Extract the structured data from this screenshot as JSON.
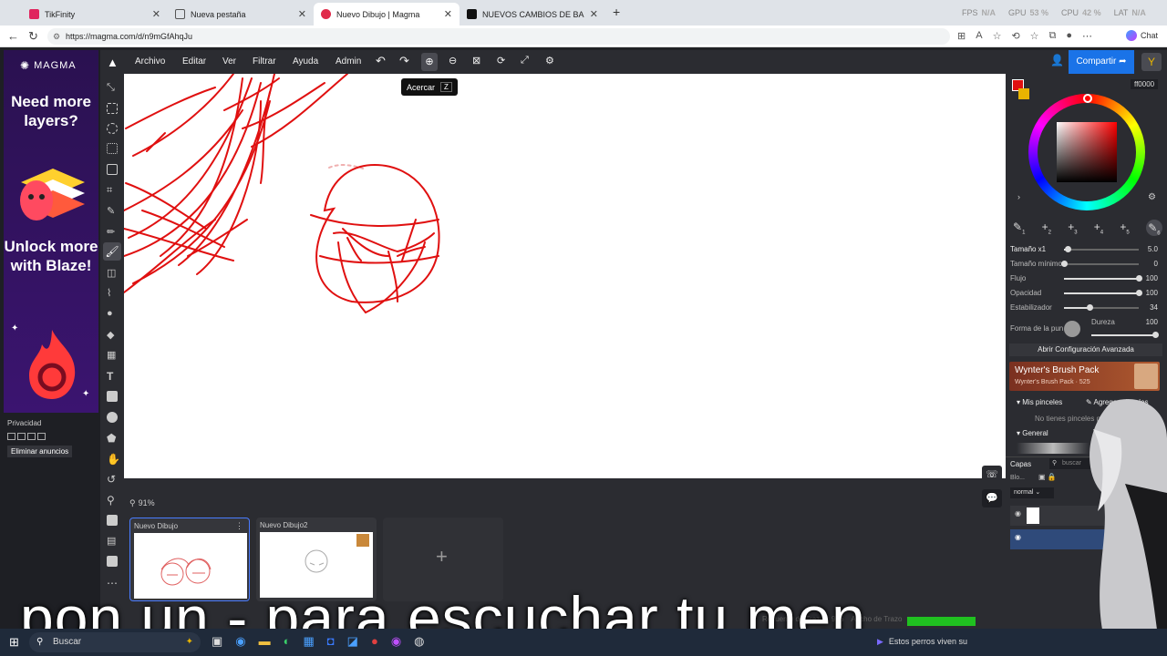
{
  "browser": {
    "tabs": [
      {
        "title": "TikFinity",
        "active": false
      },
      {
        "title": "Nueva pestaña",
        "active": false
      },
      {
        "title": "Nuevo Dibujo | Magma",
        "active": true
      },
      {
        "title": "NUEVOS CAMBIOS DE BALANCE",
        "active": false
      }
    ],
    "stats": {
      "fps_label": "FPS",
      "fps": "N/A",
      "gpu_label": "GPU",
      "gpu": "53 %",
      "cpu_label": "CPU",
      "cpu": "42 %",
      "lat_label": "LAT",
      "lat": "N/A"
    },
    "url": "https://magma.com/d/n9mGfAhqJu",
    "chat_label": "Chat"
  },
  "ad": {
    "brand": "MAGMA",
    "headline": "Need more layers?",
    "cta": "Unlock more with Blaze!",
    "privacy": "Privacidad",
    "remove_ads": "Eliminar anuncios"
  },
  "menu": {
    "items": [
      "Archivo",
      "Editar",
      "Ver",
      "Filtrar",
      "Ayuda",
      "Admin"
    ],
    "tooltip": "Acercar",
    "tooltip_key": "Z",
    "share": "Compartir"
  },
  "zoom": {
    "label": "91%"
  },
  "thumbnails": [
    {
      "title": "Nuevo Dibujo",
      "active": true
    },
    {
      "title": "Nuevo Dibujo2",
      "active": false
    }
  ],
  "add_drawing": "+",
  "color": {
    "hex": "ff0000",
    "primary": "#e01010",
    "secondary": "#e8b400"
  },
  "brush_slots": [
    "1",
    "2",
    "3",
    "4",
    "5",
    "6"
  ],
  "brush": {
    "size": {
      "label": "Tamaño x1",
      "value": "5.0",
      "level": 0.05
    },
    "min_size": {
      "label": "Tamaño mínimo",
      "value": "0",
      "level": 0
    },
    "flow": {
      "label": "Flujo",
      "value": "100",
      "level": 1
    },
    "opacity": {
      "label": "Opacidad",
      "value": "100",
      "level": 1
    },
    "stabilizer": {
      "label": "Estabilizador",
      "value": "34",
      "level": 0.34
    },
    "shape": {
      "label": "Forma de la punta"
    },
    "hardness": {
      "label": "Dureza",
      "value": "100",
      "level": 1
    },
    "advanced": "Abrir Configuración Avanzada"
  },
  "brushpack": {
    "title": "Wynter's Brush Pack",
    "subtitle": "Wynter's Brush Pack · 525"
  },
  "mybrushes": {
    "label": "Mis pinceles",
    "add": "Agregar pinceles",
    "empty": "No tienes pinceles guardados",
    "general": "General"
  },
  "layers": {
    "label": "Capas",
    "search": "buscar",
    "blend": "normal",
    "blend_short": "Blo..."
  },
  "statusbar": {
    "strokes": "Recuento de Trazos: 996",
    "tool": "Ancho de Trazo"
  },
  "subtitle": "pon un - para escuchar tu men",
  "taskbar": {
    "search": "Buscar",
    "now_playing": "Estos perros viven su"
  }
}
